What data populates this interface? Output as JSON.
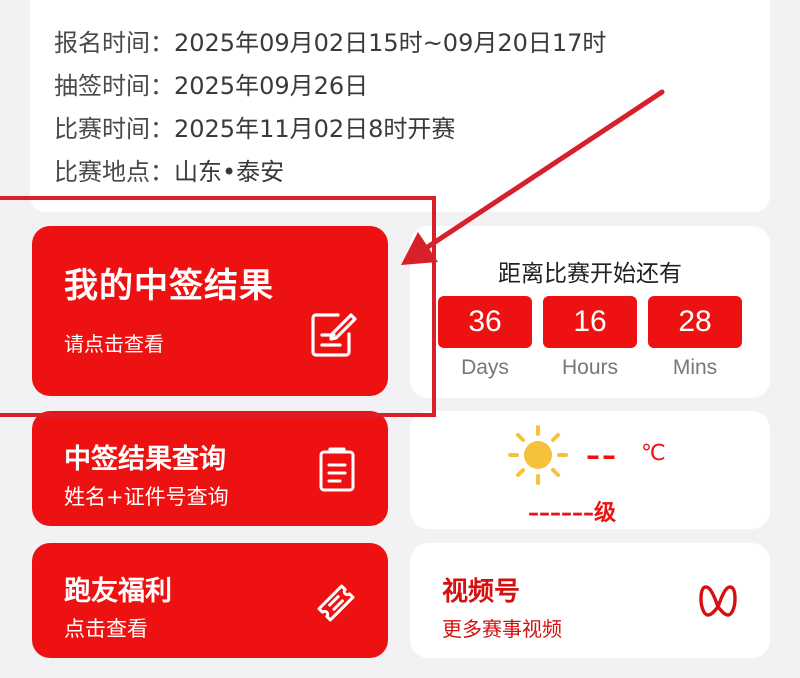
{
  "info": {
    "signup_label": "报名时间：",
    "signup_value": "2025年09月02日15时~09月20日17时",
    "draw_label": "抽签时间：",
    "draw_value": "2025年09月26日",
    "race_label": "比赛时间：",
    "race_value": "2025年11月02日8时开赛",
    "venue_label": "比赛地点：",
    "venue_value": "山东•泰安"
  },
  "result_card": {
    "title": "我的中签结果",
    "subtitle": "请点击查看",
    "icon": "edit-note-icon"
  },
  "query_card": {
    "title": "中签结果查询",
    "subtitle": "姓名+证件号查询",
    "icon": "clipboard-icon"
  },
  "benefit_card": {
    "title": "跑友福利",
    "subtitle": "点击查看",
    "icon": "ticket-icon"
  },
  "countdown": {
    "title": "距离比赛开始还有",
    "days": "36",
    "days_unit": "Days",
    "hours": "16",
    "hours_unit": "Hours",
    "mins": "28",
    "mins_unit": "Mins"
  },
  "weather": {
    "temp": "––",
    "unit": "℃",
    "wind": "––––––级",
    "icon": "sun-icon"
  },
  "video_card": {
    "title": "视频号",
    "subtitle": "更多赛事视频",
    "icon": "video-channel-icon"
  },
  "colors": {
    "brand_red": "#ee1111",
    "annotation_red": "#d8202a"
  }
}
